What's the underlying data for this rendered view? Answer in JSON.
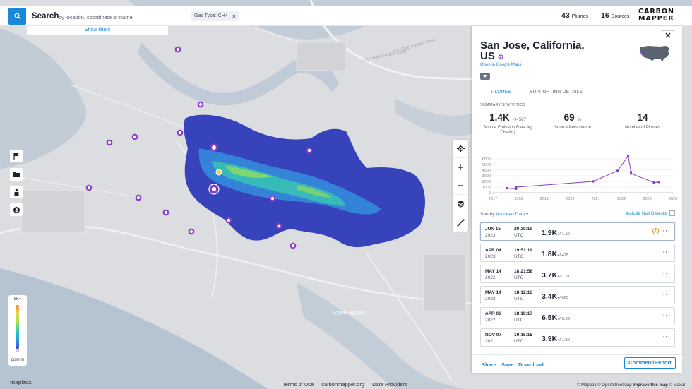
{
  "search": {
    "title": "Search",
    "placeholder": "by location, coordinate or name",
    "show_filters": "Show filters",
    "icon": "search-icon"
  },
  "filters": {
    "gas_chip": "Gas Type: CH4",
    "chip_close": "×"
  },
  "counts": {
    "plumes_value": "43",
    "plumes_label": "Plumes",
    "sources_value": "16",
    "sources_label": "Sources"
  },
  "brand": {
    "line1": "CARBON",
    "line2": "MAPPER"
  },
  "left_tools": [
    "flag-icon",
    "folder-icon",
    "person-icon",
    "badge-icon"
  ],
  "map_controls": [
    "crosshair-icon",
    "plus-icon",
    "minus-icon",
    "layers-icon",
    "ruler-icon"
  ],
  "legend": {
    "max": "6K+",
    "min": "0",
    "unit": "ppm-m"
  },
  "mapbox": "mapbox",
  "map_label": "Coyote Bypass",
  "map_roads": [
    "COYOTE CREEK LOOP",
    "COYOTE CREEK TRAIL"
  ],
  "bottom_links": {
    "terms": "Terms of Use",
    "site": "carbonmapper.org",
    "providers": "Data Providers"
  },
  "attribution": {
    "text": "© Mapbox © OpenStreetMap",
    "improve": "Improve this map",
    "maxar": "© Maxar"
  },
  "panel": {
    "title": "San Jose, California, US",
    "google_maps": "Open in Google Maps",
    "close": "✕",
    "tabs": {
      "plumes": "PLUMES",
      "supporting": "SUPPORTING DETAILS"
    },
    "summary_label": "SUMMARY STATISTICS",
    "stats": {
      "rate_value": "1.4K",
      "rate_pm": "+/- 567",
      "rate_label": "Source Emission Rate (kg CH4/hr)",
      "persistence_value": "69",
      "persistence_unit": "%",
      "persistence_label": "Source Persistence",
      "plumes_value": "14",
      "plumes_label": "Number of Plumes"
    },
    "sort": {
      "prefix": "Sort by",
      "value": "Acquired Date",
      "include_null": "Include Null Detects"
    },
    "rows": [
      {
        "date": "JUN 15",
        "year": "2023",
        "time": "20:20:19",
        "tz": "UTC",
        "emission": "1.9K",
        "pm": "+/-1.1K",
        "warn": true,
        "selected": true
      },
      {
        "date": "APR 04",
        "year": "2023",
        "time": "19:51:19",
        "tz": "UTC",
        "emission": "1.8K",
        "pm": "+/-425",
        "warn": false,
        "selected": false
      },
      {
        "date": "MAY 14",
        "year": "2022",
        "time": "18:21:58",
        "tz": "UTC",
        "emission": "3.7K",
        "pm": "+/-1.1K",
        "warn": false,
        "selected": false
      },
      {
        "date": "MAY 14",
        "year": "2022",
        "time": "18:12:16",
        "tz": "UTC",
        "emission": "3.4K",
        "pm": "+/-905",
        "warn": false,
        "selected": false
      },
      {
        "date": "APR 06",
        "year": "2022",
        "time": "18:18:17",
        "tz": "UTC",
        "emission": "6.5K",
        "pm": "+/-3.2K",
        "warn": false,
        "selected": false
      },
      {
        "date": "NOV 07",
        "year": "2021",
        "time": "19:15:15",
        "tz": "UTC",
        "emission": "3.9K",
        "pm": "+/-1.5K",
        "warn": false,
        "selected": false
      }
    ],
    "footer": {
      "share": "Share",
      "save": "Save",
      "download": "Download",
      "comment": "Comment/Report"
    }
  },
  "chart_data": {
    "type": "line",
    "x_ticks": [
      "2017",
      "2018",
      "2019",
      "2020",
      "2021",
      "2022",
      "2023",
      "2024"
    ],
    "y_ticks": [
      "0",
      "1000",
      "2000",
      "3000",
      "4000",
      "5000",
      "6000"
    ],
    "ylim": [
      0,
      7000
    ],
    "xlim": [
      2017,
      2024
    ],
    "color": "#8a3ec9",
    "points": [
      {
        "x": 2017.55,
        "y": 800
      },
      {
        "x": 2017.9,
        "y": 700
      },
      {
        "x": 2017.9,
        "y": 1000
      },
      {
        "x": 2020.9,
        "y": 2000
      },
      {
        "x": 2021.85,
        "y": 3900
      },
      {
        "x": 2022.26,
        "y": 6500
      },
      {
        "x": 2022.37,
        "y": 3700
      },
      {
        "x": 2022.37,
        "y": 3400
      },
      {
        "x": 2023.26,
        "y": 1800
      },
      {
        "x": 2023.45,
        "y": 1900
      }
    ]
  }
}
